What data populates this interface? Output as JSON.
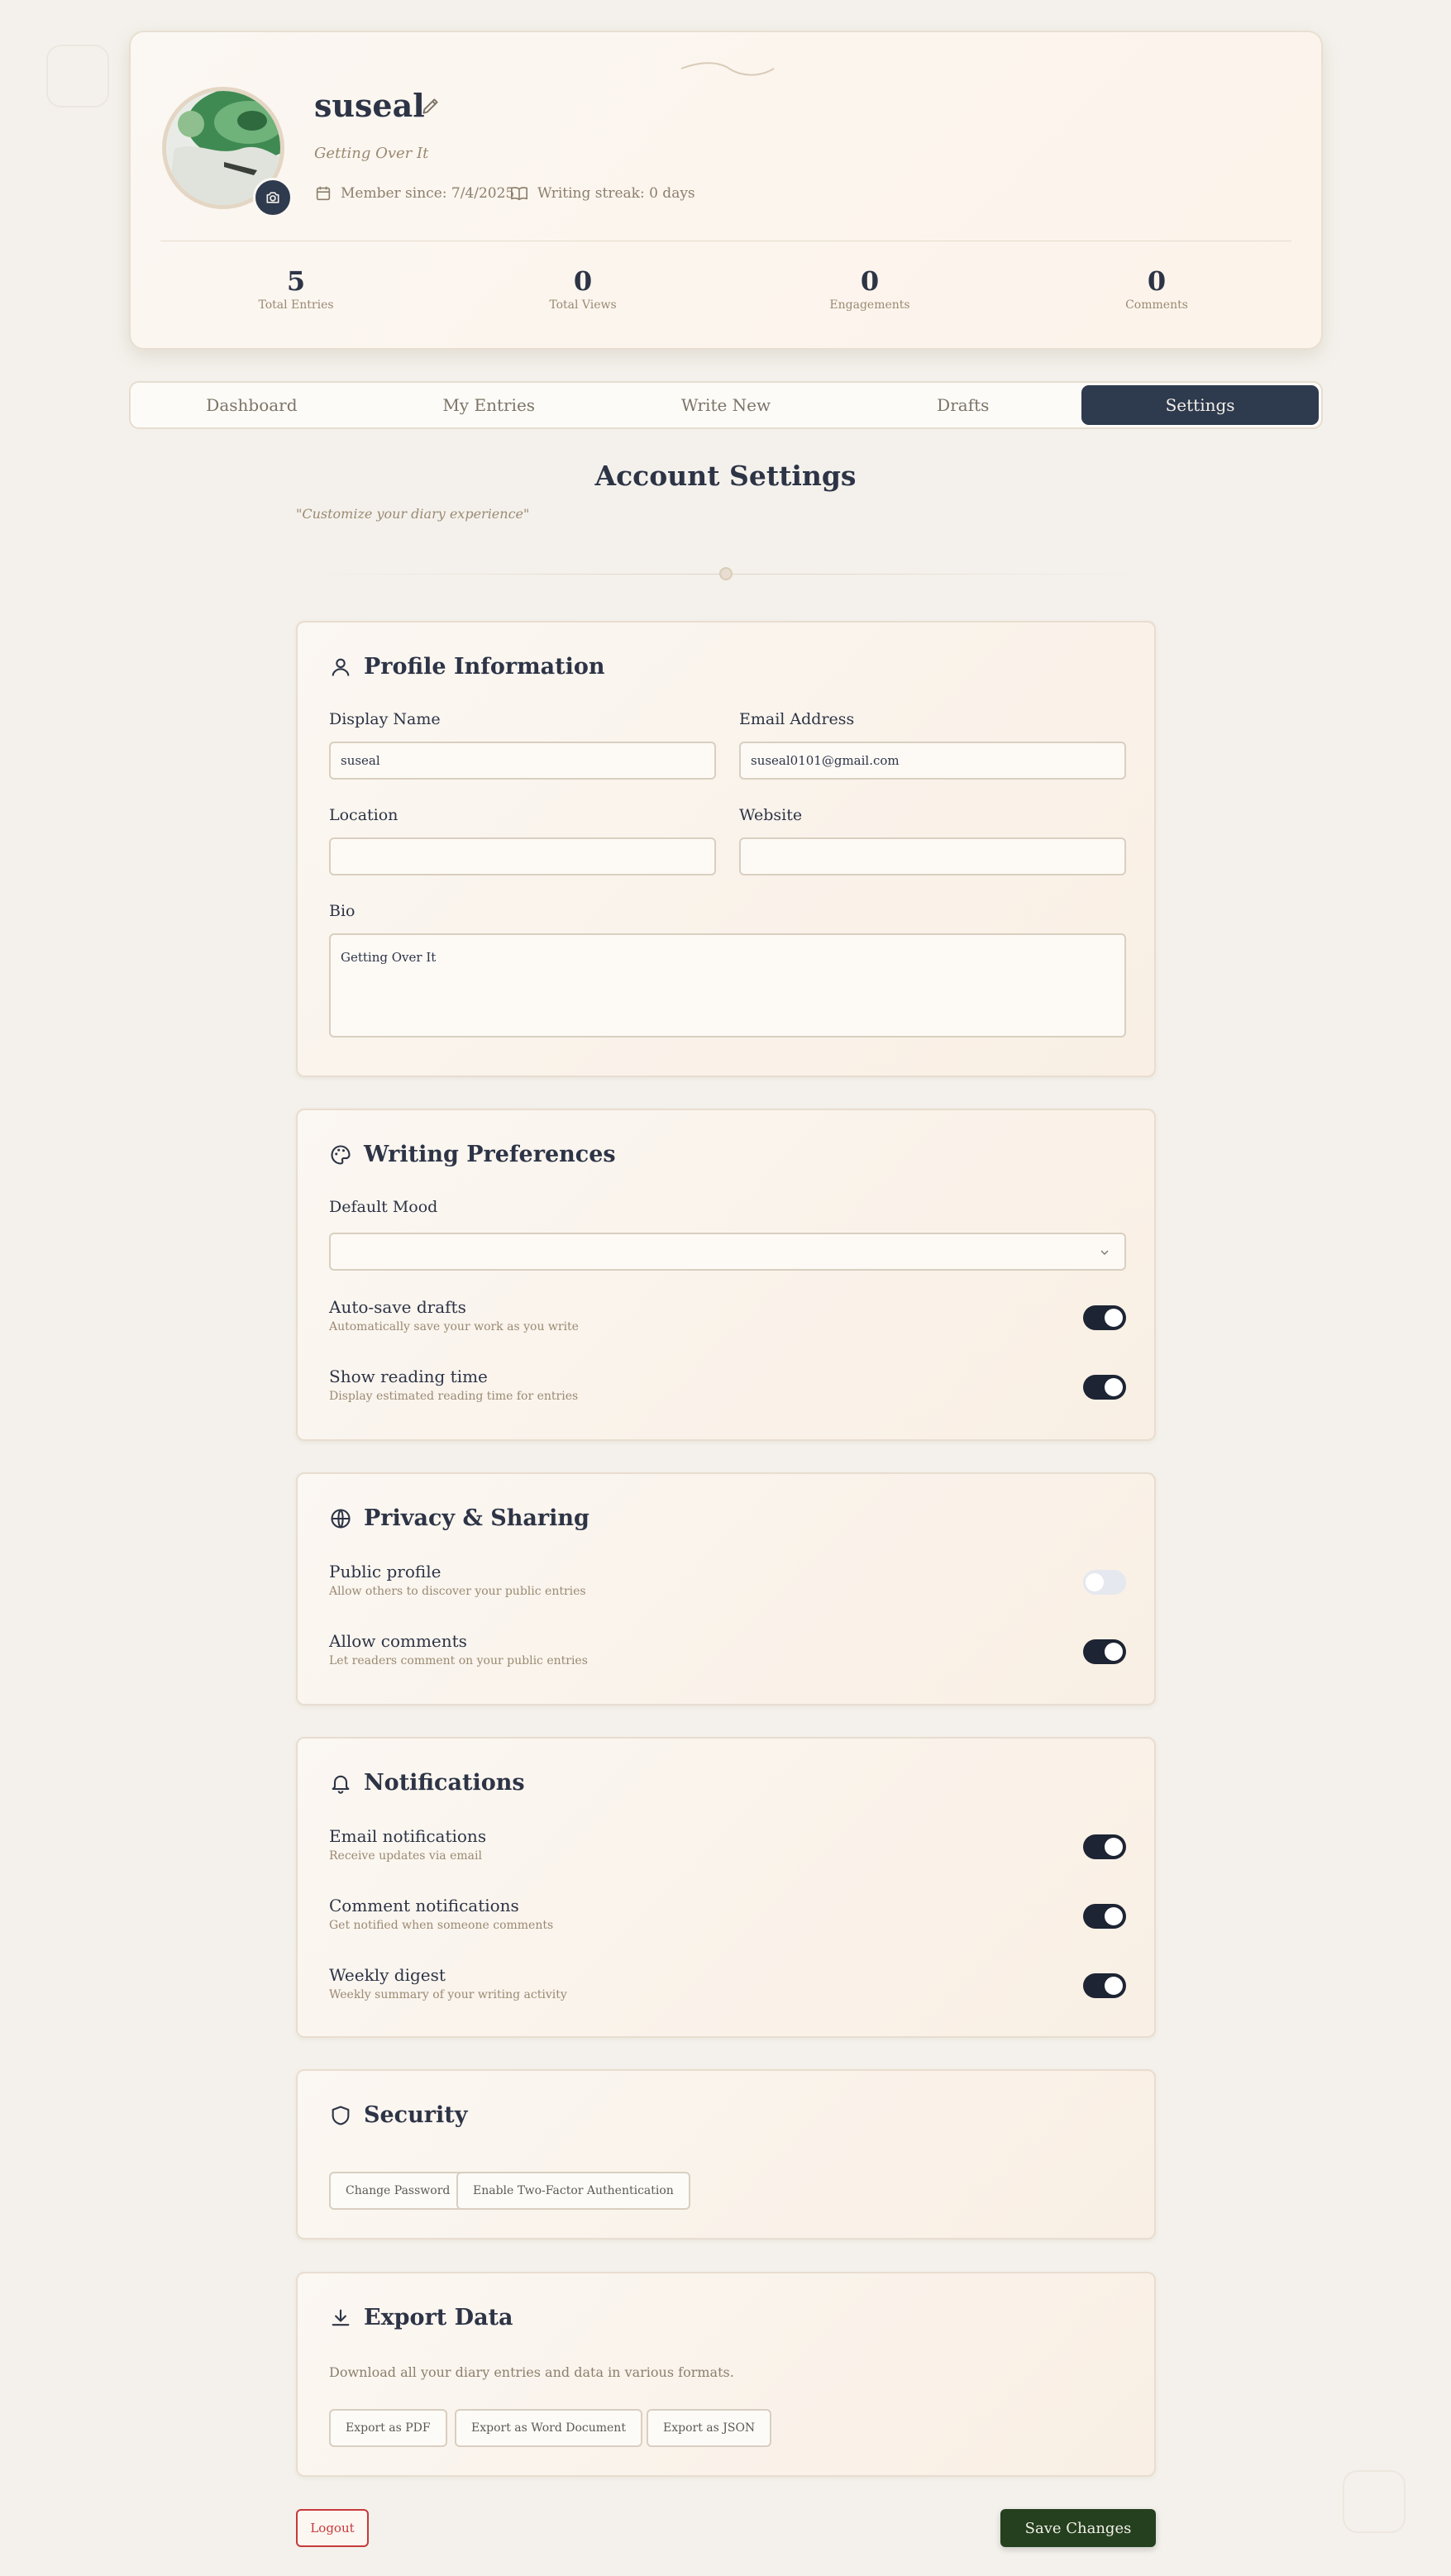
{
  "profile": {
    "username": "suseal",
    "tagline": "Getting Over It",
    "member_since": "Member since: 7/4/2025",
    "writing_streak": "Writing streak: 0 days",
    "stats": [
      {
        "value": "5",
        "label": "Total Entries"
      },
      {
        "value": "0",
        "label": "Total Views"
      },
      {
        "value": "0",
        "label": "Engagements"
      },
      {
        "value": "0",
        "label": "Comments"
      }
    ]
  },
  "tabs": [
    {
      "label": "Dashboard",
      "active": false
    },
    {
      "label": "My Entries",
      "active": false
    },
    {
      "label": "Write New",
      "active": false
    },
    {
      "label": "Drafts",
      "active": false
    },
    {
      "label": "Settings",
      "active": true
    }
  ],
  "page": {
    "title": "Account Settings",
    "subtitle": "\"Customize your diary experience\""
  },
  "profile_info": {
    "title": "Profile Information",
    "display_name_label": "Display Name",
    "display_name_value": "suseal",
    "email_label": "Email Address",
    "email_value": "suseal0101@gmail.com",
    "location_label": "Location",
    "location_value": "",
    "website_label": "Website",
    "website_value": "",
    "bio_label": "Bio",
    "bio_value": "Getting Over It"
  },
  "writing_prefs": {
    "title": "Writing Preferences",
    "default_mood_label": "Default Mood",
    "default_mood_value": "",
    "toggles": [
      {
        "label": "Auto-save drafts",
        "desc": "Automatically save your work as you write",
        "on": true
      },
      {
        "label": "Show reading time",
        "desc": "Display estimated reading time for entries",
        "on": true
      }
    ]
  },
  "privacy": {
    "title": "Privacy & Sharing",
    "toggles": [
      {
        "label": "Public profile",
        "desc": "Allow others to discover your public entries",
        "on": false
      },
      {
        "label": "Allow comments",
        "desc": "Let readers comment on your public entries",
        "on": true
      }
    ]
  },
  "notifications": {
    "title": "Notifications",
    "toggles": [
      {
        "label": "Email notifications",
        "desc": "Receive updates via email",
        "on": true
      },
      {
        "label": "Comment notifications",
        "desc": "Get notified when someone comments",
        "on": true
      },
      {
        "label": "Weekly digest",
        "desc": "Weekly summary of your writing activity",
        "on": true
      }
    ]
  },
  "security": {
    "title": "Security",
    "change_password": "Change Password",
    "enable_2fa": "Enable Two-Factor Authentication"
  },
  "export": {
    "title": "Export Data",
    "desc": "Download all your diary entries and data in various formats.",
    "pdf": "Export as PDF",
    "word": "Export as Word Document",
    "json": "Export as JSON"
  },
  "footer": {
    "logout": "Logout",
    "save": "Save Changes"
  },
  "colors": {
    "accent_dark": "#2e3a4e",
    "save_green": "#24401f",
    "logout_red": "#c63a3a",
    "toggle_on": "#1d2433"
  }
}
